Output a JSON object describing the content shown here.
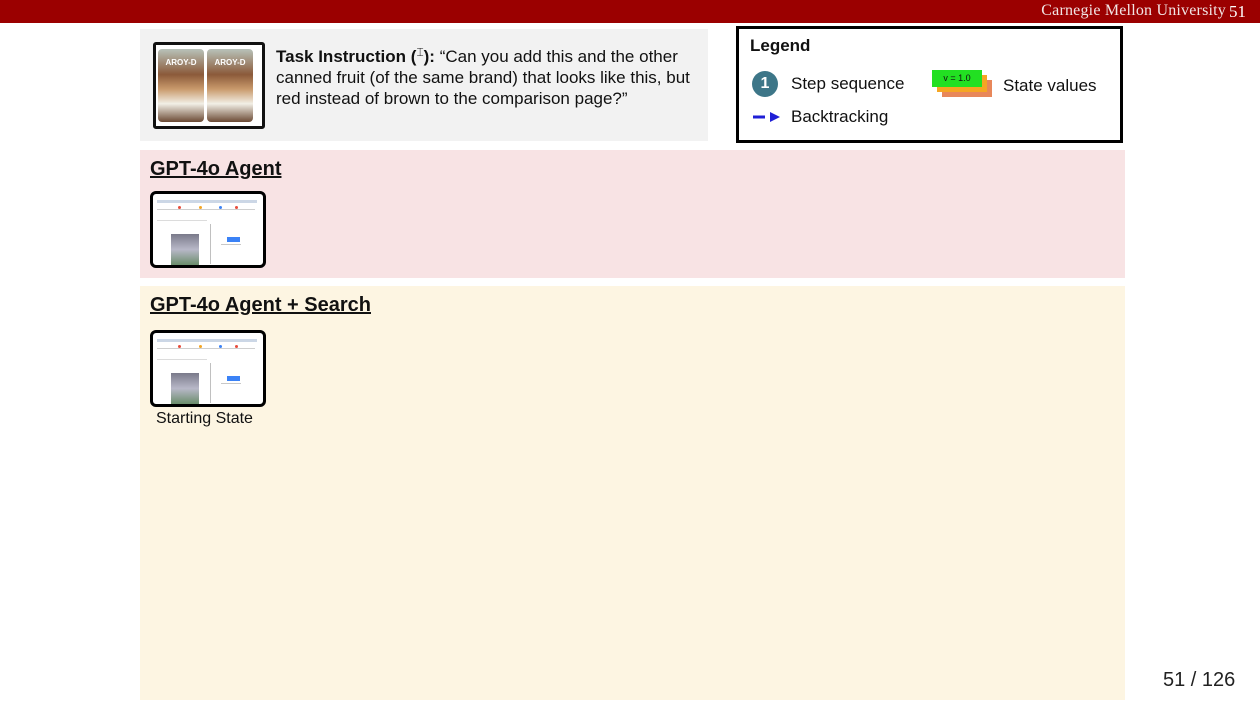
{
  "header": {
    "brand": "Carnegie Mellon University",
    "slide_number": "51"
  },
  "task": {
    "label": "Task Instruction (",
    "label_close": "):",
    "quote": "“Can you add this and the other canned fruit (of the same brand) that looks like this, but red instead of brown to the comparison page?”",
    "image_label": "AROY-D"
  },
  "legend": {
    "title": "Legend",
    "step_number": "1",
    "step_label": "Step sequence",
    "backtracking_label": "Backtracking",
    "state_value_chip": "v = 1.0",
    "state_values_label": "State values"
  },
  "panels": {
    "gpt4o": {
      "title": "GPT-4o Agent"
    },
    "gpt4o_search": {
      "title": "GPT-4o Agent + Search",
      "caption": "Starting State"
    }
  },
  "footer": {
    "page_count": "51 / 126"
  },
  "colors": {
    "topbar": "#9b0000",
    "panel_gpt4o": "#f8e3e4",
    "panel_search": "#fdf5e2",
    "step_circle": "#3d7688",
    "backtrack_arrow": "#1f1fd6"
  }
}
